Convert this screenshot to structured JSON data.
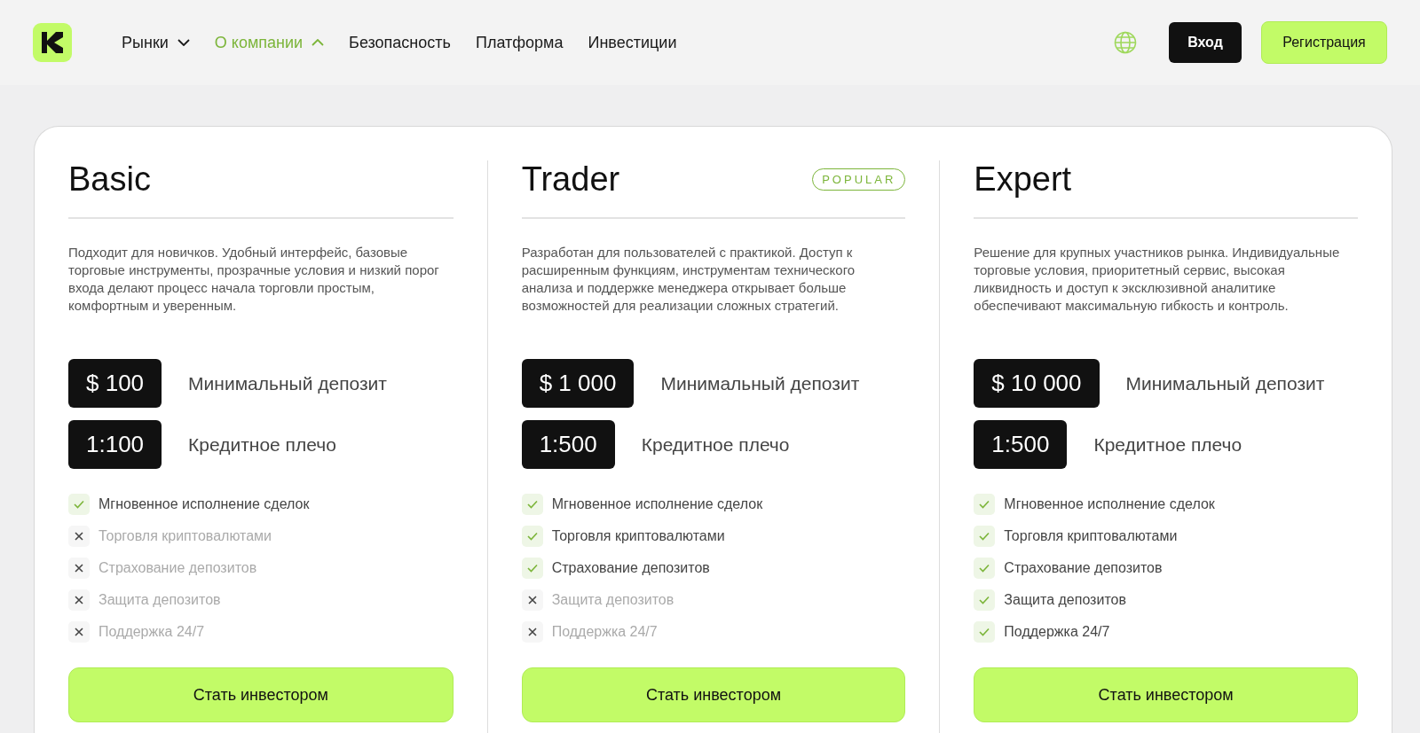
{
  "nav": [
    {
      "label": "Рынки",
      "kind": "dropdown",
      "expanded": false,
      "selected": false
    },
    {
      "label": "О компании",
      "kind": "dropdown",
      "expanded": true,
      "selected": true
    },
    {
      "label": "Безопасность",
      "kind": "link",
      "selected": false
    },
    {
      "label": "Платформа",
      "kind": "link",
      "selected": false
    },
    {
      "label": "Инвестиции",
      "kind": "link",
      "selected": false
    }
  ],
  "login": "Вход",
  "register": "Регистрация",
  "plans": [
    {
      "name": "Basic",
      "description": "Подходит для новичков. Удобный интерфейс, базовые торговые инструменты, прозрачные условия и низкий порог входа делают процесс начала торговли простым, комфортным и уверенным.",
      "deposit": "$ 100",
      "deposit_label": "Минимальный депозит",
      "leverage": "1:100",
      "leverage_label": "Кредитное плечо",
      "features": [
        {
          "label": "Мгновенное исполнение сделок",
          "included": true
        },
        {
          "label": "Торговля криптовалютами",
          "included": false
        },
        {
          "label": "Страхование депозитов",
          "included": false
        },
        {
          "label": "Защита депозитов",
          "included": false
        },
        {
          "label": "Поддержка 24/7",
          "included": false
        }
      ],
      "button": "Стать инвестором"
    },
    {
      "name": "Trader",
      "badge": "POPULAR",
      "description": "Разработан для пользователей с практикой. Доступ к расширенным функциям, инструментам технического анализа и поддержке менеджера открывает больше возможностей для реализации сложных стратегий.",
      "deposit": "$ 1 000",
      "deposit_label": "Минимальный депозит",
      "leverage": "1:500",
      "leverage_label": "Кредитное плечо",
      "features": [
        {
          "label": "Мгновенное исполнение сделок",
          "included": true
        },
        {
          "label": "Торговля криптовалютами",
          "included": true
        },
        {
          "label": "Страхование депозитов",
          "included": true
        },
        {
          "label": "Защита депозитов",
          "included": false
        },
        {
          "label": "Поддержка 24/7",
          "included": false
        }
      ],
      "button": "Стать инвестором"
    },
    {
      "name": "Expert",
      "description": "Решение для крупных участников рынка. Индивидуальные торговые условия, приоритетный сервис, высокая ликвидность и доступ к эксклюзивной аналитике обеспечивают максимальную гибкость и контроль.",
      "deposit": "$ 10 000",
      "deposit_label": "Минимальный депозит",
      "leverage": "1:500",
      "leverage_label": "Кредитное плечо",
      "features": [
        {
          "label": "Мгновенное исполнение сделок",
          "included": true
        },
        {
          "label": "Торговля криптовалютами",
          "included": true
        },
        {
          "label": "Страхование депозитов",
          "included": true
        },
        {
          "label": "Защита депозитов",
          "included": true
        },
        {
          "label": "Поддержка 24/7",
          "included": true
        }
      ],
      "button": "Стать инвестором"
    }
  ]
}
